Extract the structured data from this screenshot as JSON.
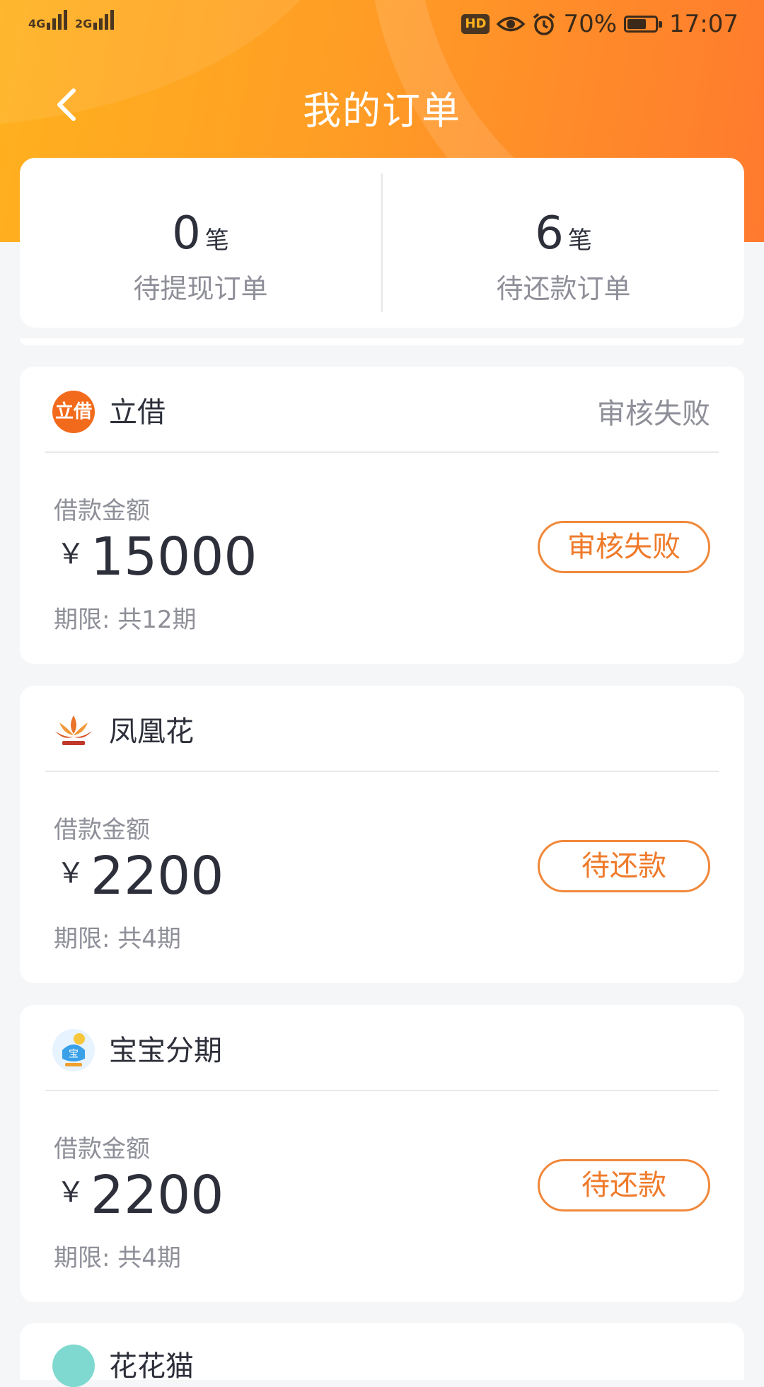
{
  "status_bar": {
    "sim1": "4G",
    "sim2": "2G",
    "hd": "HD",
    "battery_pct": "70%",
    "battery_fraction": 0.62,
    "time": "17:07"
  },
  "nav": {
    "title": "我的订单"
  },
  "summary": {
    "withdraw": {
      "count": "0",
      "unit": "笔",
      "label": "待提现订单"
    },
    "repay": {
      "count": "6",
      "unit": "笔",
      "label": "待还款订单"
    }
  },
  "orders": [
    {
      "logo_text": "立借",
      "name": "立借",
      "state": "审核失败",
      "amount_label": "借款金额",
      "currency": "￥",
      "amount": "15000",
      "term": "期限: 共12期",
      "button": "审核失败"
    },
    {
      "name": "凤凰花",
      "state": "",
      "amount_label": "借款金额",
      "currency": "￥",
      "amount": "2200",
      "term": "期限: 共4期",
      "button": "待还款"
    },
    {
      "name": "宝宝分期",
      "state": "",
      "amount_label": "借款金额",
      "currency": "￥",
      "amount": "2200",
      "term": "期限: 共4期",
      "button": "待还款"
    }
  ],
  "next_order": {
    "name": "花花猫"
  },
  "colors": {
    "accent": "#ef7a2a",
    "header_start": "#ffb11e",
    "header_end": "#ff7a2e"
  }
}
